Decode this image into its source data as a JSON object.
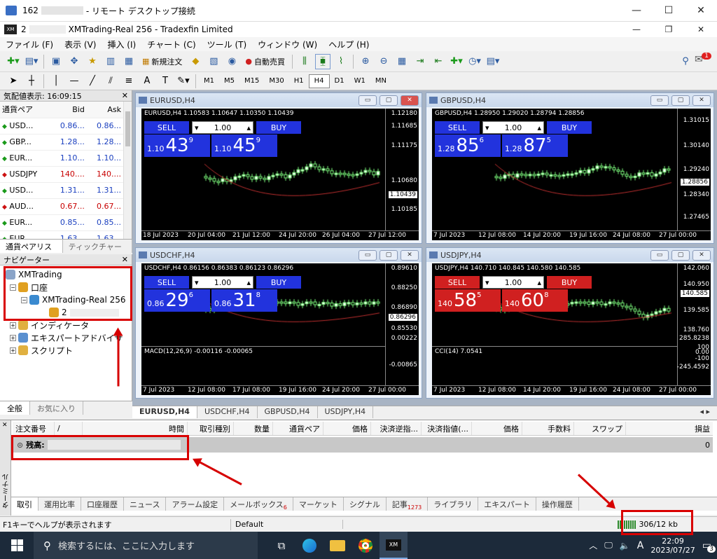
{
  "rdp": {
    "title": "162",
    "title_suffix": "- リモート デスクトップ接続"
  },
  "app": {
    "title_prefix": "2",
    "title": "XMTrading-Real 256 - Tradexfin Limited"
  },
  "menu": [
    "ファイル (F)",
    "表示 (V)",
    "挿入 (I)",
    "チャート (C)",
    "ツール (T)",
    "ウィンドウ (W)",
    "ヘルプ (H)"
  ],
  "toolbar": {
    "new_order": "新規注文",
    "auto_trade": "自動売買",
    "notify_count": "1"
  },
  "timeframes": [
    "M1",
    "M5",
    "M15",
    "M30",
    "H1",
    "H4",
    "D1",
    "W1",
    "MN"
  ],
  "active_timeframe": "H4",
  "market_watch": {
    "title": "気配値表示: 16:09:15",
    "col_symbol": "通貨ペア",
    "col_bid": "Bid",
    "col_ask": "Ask",
    "rows": [
      {
        "sym": "USD...",
        "bid": "0.86...",
        "ask": "0.86...",
        "dir": "up"
      },
      {
        "sym": "GBP...",
        "bid": "1.28...",
        "ask": "1.28...",
        "dir": "up"
      },
      {
        "sym": "EUR...",
        "bid": "1.10...",
        "ask": "1.10...",
        "dir": "up"
      },
      {
        "sym": "USDJPY",
        "bid": "140....",
        "ask": "140....",
        "dir": "down"
      },
      {
        "sym": "USD...",
        "bid": "1.31...",
        "ask": "1.31...",
        "dir": "up"
      },
      {
        "sym": "AUD...",
        "bid": "0.67...",
        "ask": "0.67...",
        "dir": "down"
      },
      {
        "sym": "EUR...",
        "bid": "0.85...",
        "ask": "0.85...",
        "dir": "up"
      },
      {
        "sym": "EUR...",
        "bid": "1.63...",
        "ask": "1.63...",
        "dir": "up"
      }
    ],
    "tab_symbols": "通貨ペアリスト",
    "tab_tick": "ティックチャート"
  },
  "navigator": {
    "title": "ナビゲーター",
    "root": "XMTrading",
    "accounts": "口座",
    "account": "XMTrading-Real 256",
    "account_num": "2",
    "indicators": "インディケータ",
    "experts": "エキスパートアドバイザ",
    "scripts": "スクリプト",
    "tab_general": "全般",
    "tab_favorites": "お気に入り"
  },
  "charts": [
    {
      "title": "EURUSD,H4",
      "hdr": "EURUSD,H4  1.10583 1.10647 1.10350 1.10439",
      "sell": "SELL",
      "buy": "BUY",
      "lot": "1.00",
      "sell_small": "1.10",
      "sell_big": "43",
      "sell_pip": "9",
      "buy_small": "1.10",
      "buy_big": "45",
      "buy_pip": "9",
      "prices": [
        "1.12180",
        "1.11685",
        "1.11175",
        "1.10680",
        "1.10439",
        "1.10185"
      ],
      "dates": [
        "18 Jul 2023",
        "20 Jul 04:00",
        "21 Jul 12:00",
        "24 Jul 20:00",
        "26 Jul 04:00",
        "27 Jul 12:00"
      ],
      "red": false
    },
    {
      "title": "GBPUSD,H4",
      "hdr": "GBPUSD,H4  1.28950 1.29020 1.28794 1.28856",
      "sell": "SELL",
      "buy": "BUY",
      "lot": "1.00",
      "sell_small": "1.28",
      "sell_big": "85",
      "sell_pip": "6",
      "buy_small": "1.28",
      "buy_big": "87",
      "buy_pip": "5",
      "prices": [
        "1.31015",
        "1.30140",
        "1.29240",
        "1.28856",
        "1.28340",
        "1.27465"
      ],
      "dates": [
        "7 Jul 2023",
        "12 Jul 08:00",
        "14 Jul 20:00",
        "19 Jul 16:00",
        "24 Jul 08:00",
        "27 Jul 00:00"
      ],
      "red": false
    },
    {
      "title": "USDCHF,H4",
      "hdr": "USDCHF,H4  0.86156 0.86383 0.86123 0.86296",
      "sell": "SELL",
      "buy": "BUY",
      "lot": "1.00",
      "sell_small": "0.86",
      "sell_big": "29",
      "sell_pip": "6",
      "buy_small": "0.86",
      "buy_big": "31",
      "buy_pip": "8",
      "prices": [
        "0.89610",
        "0.88250",
        "0.86890",
        "0.86296",
        "0.85530",
        "0.00222",
        "-0.00865"
      ],
      "sub": "MACD(12,26,9) -0.00116 -0.00065",
      "dates": [
        "7 Jul 2023",
        "12 Jul 08:00",
        "17 Jul 08:00",
        "19 Jul 16:00",
        "24 Jul 20:00",
        "27 Jul 00:00"
      ],
      "red": false
    },
    {
      "title": "USDJPY,H4",
      "hdr": "USDJPY,H4  140.710 140.845 140.580 140.585",
      "sell": "SELL",
      "buy": "BUY",
      "lot": "1.00",
      "sell_small": "140",
      "sell_big": "58",
      "sell_pip": "5",
      "buy_small": "140",
      "buy_big": "60",
      "buy_pip": "8",
      "prices": [
        "142.060",
        "140.950",
        "140.585",
        "139.585",
        "138.760",
        "285.8238",
        "100",
        "0.00",
        "-100",
        "-245.4592"
      ],
      "sub": "CCI(14) 7.0541",
      "dates": [
        "7 Jul 2023",
        "12 Jul 08:00",
        "14 Jul 20:00",
        "19 Jul 16:00",
        "24 Jul 08:00",
        "27 Jul 00:00"
      ],
      "red": true
    }
  ],
  "chart_tabs": [
    "EURUSD,H4",
    "USDCHF,H4",
    "GBPUSD,H4",
    "USDJPY,H4"
  ],
  "terminal": {
    "label": "ターミナル",
    "cols": [
      "注文番号",
      "/",
      "時間",
      "取引種別",
      "数量",
      "通貨ペア",
      "価格",
      "決済逆指...",
      "決済指値(...",
      "価格",
      "手数料",
      "スワップ",
      "損益"
    ],
    "balance_label": "残高:",
    "balance_value": "0",
    "tabs": [
      "取引",
      "運用比率",
      "口座履歴",
      "ニュース",
      "アラーム設定",
      "メールボックス",
      "マーケット",
      "シグナル",
      "記事",
      "ライブラリ",
      "エキスパート",
      "操作履歴"
    ],
    "mail_badge": "6",
    "articles_badge": "1273"
  },
  "status": {
    "help": "F1キーでヘルプが表示されます",
    "profile": "Default",
    "traffic": "306/12 kb"
  },
  "taskbar": {
    "search": "検索するには、ここに入力します",
    "time": "22:09",
    "date": "2023/07/27",
    "notify": "3",
    "ime": "A"
  }
}
